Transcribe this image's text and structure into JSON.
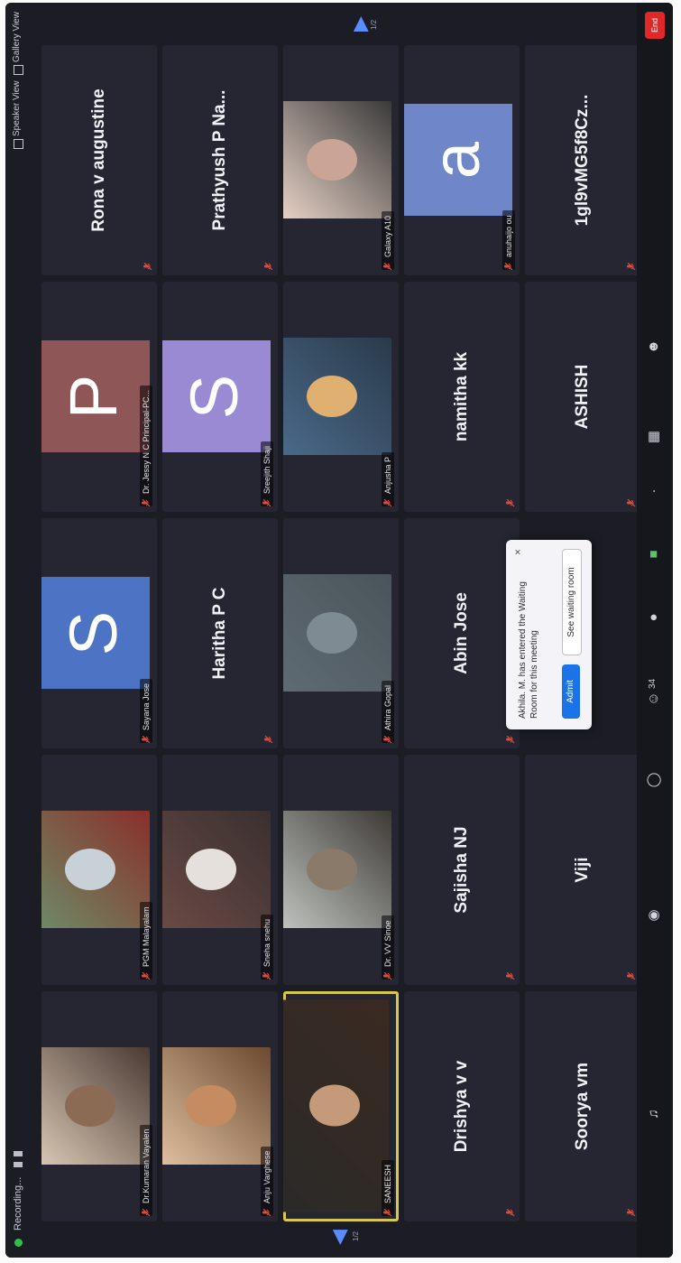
{
  "topbar": {
    "recording_label": "Recording...",
    "speaker_view_label": "Speaker View",
    "gallery_view_label": "Gallery View"
  },
  "pagination": {
    "prev_page": "1/2",
    "next_page": "1/2"
  },
  "participants": [
    {
      "id": "p1",
      "name": "Dr.Kumaran Vayalen",
      "kind": "video"
    },
    {
      "id": "p2",
      "name": "Anju Varghese",
      "kind": "video"
    },
    {
      "id": "p3",
      "name": "SANEESH",
      "kind": "video",
      "speaking": true
    },
    {
      "id": "p4",
      "name": "Drishya v v",
      "kind": "name"
    },
    {
      "id": "p5",
      "name": "Soorya vm",
      "kind": "name"
    },
    {
      "id": "p6",
      "name": "PGM Malayalam",
      "kind": "video"
    },
    {
      "id": "p7",
      "name": "Sneha snehu",
      "kind": "video"
    },
    {
      "id": "p8",
      "name": "Dr. VV Sinoe",
      "kind": "video"
    },
    {
      "id": "p9",
      "name": "Sajisha NJ",
      "kind": "name"
    },
    {
      "id": "p10",
      "name": "Viji",
      "kind": "name"
    },
    {
      "id": "p11",
      "name": "Sayana Jose",
      "kind": "avatar",
      "letter": "S",
      "color": "#4d74c4"
    },
    {
      "id": "p12",
      "name": "Haritha P C",
      "kind": "name"
    },
    {
      "id": "p13",
      "name": "Athira Gopal",
      "kind": "video"
    },
    {
      "id": "p14",
      "name": "Abin Jose",
      "kind": "name"
    },
    {
      "id": "p15",
      "name": "Dr. Jessy N C Principal-PC...",
      "kind": "avatar",
      "letter": "P",
      "color": "#8e5656"
    },
    {
      "id": "p16",
      "name": "Sreejith Shaji",
      "kind": "avatar",
      "letter": "S",
      "color": "#9a8ad4"
    },
    {
      "id": "p17",
      "name": "Anjusha P",
      "kind": "video"
    },
    {
      "id": "p18",
      "name": "namitha kk",
      "kind": "name"
    },
    {
      "id": "p19",
      "name": "ASHISH",
      "kind": "name"
    },
    {
      "id": "p20",
      "name": "Rona v augustine",
      "kind": "name"
    },
    {
      "id": "p21",
      "name": "Prathyush P Na...",
      "kind": "name"
    },
    {
      "id": "p22",
      "name": "Galaxy A10",
      "kind": "video"
    },
    {
      "id": "p23",
      "name": "anuhaijo ou",
      "kind": "avatar",
      "letter": "a",
      "color": "#6f86c9"
    },
    {
      "id": "p24",
      "name": "1gl9vMG5f8Cz...",
      "kind": "name"
    }
  ],
  "waiting_room": {
    "message": "Akhila. M. has entered the Waiting Room for this meeting",
    "admit_label": "Admit",
    "see_label": "See waiting room",
    "close_symbol": "×"
  },
  "toolbar": {
    "participants_count": "34",
    "end_label": "End",
    "icons": [
      "audio-icon",
      "video-icon",
      "share-icon",
      "participants-icon",
      "chat-icon",
      "record-icon",
      "reactions-icon",
      "apps-icon",
      "more-icon"
    ]
  }
}
